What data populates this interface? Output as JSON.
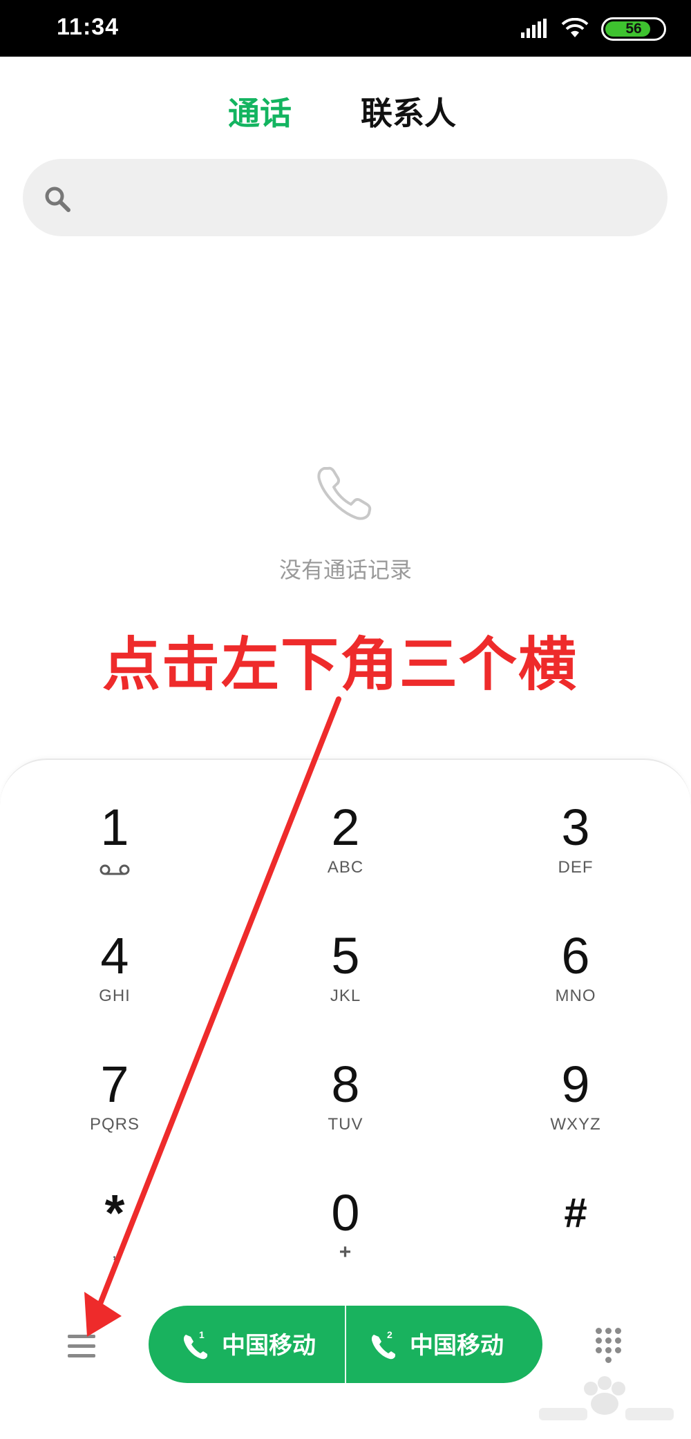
{
  "status_bar": {
    "time": "11:34",
    "battery": "56",
    "icons": [
      "signal-icon",
      "wifi-icon",
      "battery-icon"
    ]
  },
  "tabs": [
    {
      "label": "通话",
      "active": true
    },
    {
      "label": "联系人",
      "active": false
    }
  ],
  "search": {
    "placeholder": "",
    "icon": "search-icon"
  },
  "empty_state": {
    "icon": "phone-outline-icon",
    "text": "没有通话记录"
  },
  "annotation": {
    "text": "点击左下角三个横",
    "color": "#ee2b2b"
  },
  "dialpad": {
    "keys": [
      {
        "digit": "1",
        "letters": ""
      },
      {
        "digit": "2",
        "letters": "ABC"
      },
      {
        "digit": "3",
        "letters": "DEF"
      },
      {
        "digit": "4",
        "letters": "GHI"
      },
      {
        "digit": "5",
        "letters": "JKL"
      },
      {
        "digit": "6",
        "letters": "MNO"
      },
      {
        "digit": "7",
        "letters": "PQRS"
      },
      {
        "digit": "8",
        "letters": "TUV"
      },
      {
        "digit": "9",
        "letters": "WXYZ"
      },
      {
        "digit": "*",
        "letters": ","
      },
      {
        "digit": "0",
        "letters": "+"
      },
      {
        "digit": "#",
        "letters": ""
      }
    ]
  },
  "bottom_bar": {
    "menu_icon": "hamburger-menu-icon",
    "sim1": {
      "label": "中国移动",
      "slot": "1"
    },
    "sim2": {
      "label": "中国移动",
      "slot": "2"
    },
    "keypad_icon": "dialpad-grid-icon"
  },
  "colors": {
    "accent": "#13b460",
    "call_button": "#19b25e",
    "annotation": "#ee2b2b"
  }
}
